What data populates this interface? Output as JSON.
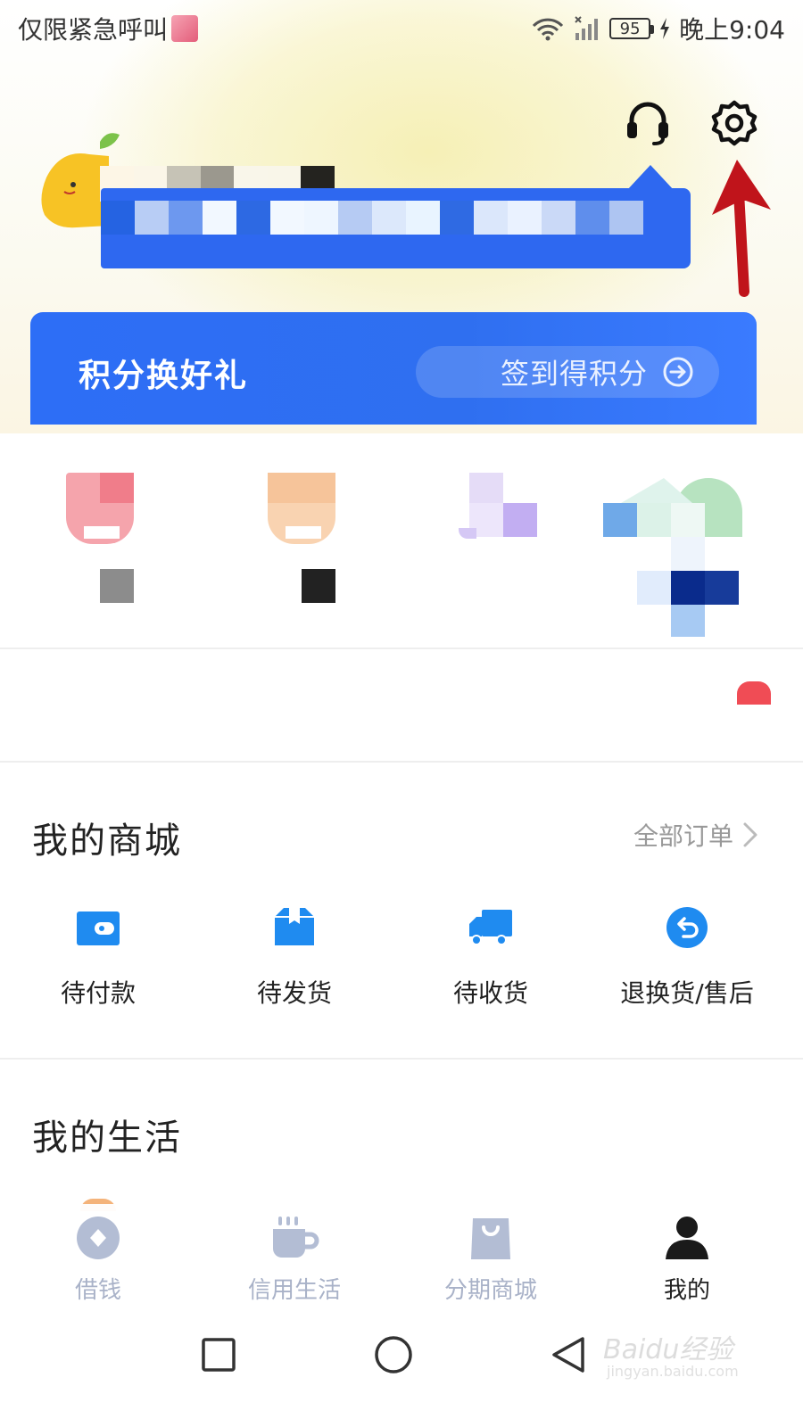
{
  "status_bar": {
    "carrier_text": "仅限紧急呼叫",
    "battery_level": "95",
    "time": "晚上9:04"
  },
  "header": {
    "icons": [
      "headset-icon",
      "gear-icon"
    ]
  },
  "points_card": {
    "title": "积分换好礼",
    "signin_label": "签到得积分"
  },
  "my_mall": {
    "title": "我的商城",
    "all_orders_label": "全部订单",
    "items": [
      {
        "label": "待付款",
        "icon": "wallet-icon"
      },
      {
        "label": "待发货",
        "icon": "box-icon"
      },
      {
        "label": "待收货",
        "icon": "truck-icon"
      },
      {
        "label": "退换货/售后",
        "icon": "return-icon"
      }
    ]
  },
  "my_life": {
    "title": "我的生活"
  },
  "bottom_nav": {
    "items": [
      {
        "label": "借钱",
        "icon": "coin-icon",
        "active": false
      },
      {
        "label": "信用生活",
        "icon": "cup-icon",
        "active": false
      },
      {
        "label": "分期商城",
        "icon": "bag-icon",
        "active": false
      },
      {
        "label": "我的",
        "icon": "person-icon",
        "active": true
      }
    ]
  },
  "watermark": {
    "text": "Baidu经验",
    "url_text": "jingyan.baidu.com"
  },
  "colors": {
    "brand_blue": "#2e68f0",
    "accent_icon_blue": "#1f8bf0",
    "nav_inactive": "#a9b2c8",
    "arrow_red": "#c0141b"
  }
}
